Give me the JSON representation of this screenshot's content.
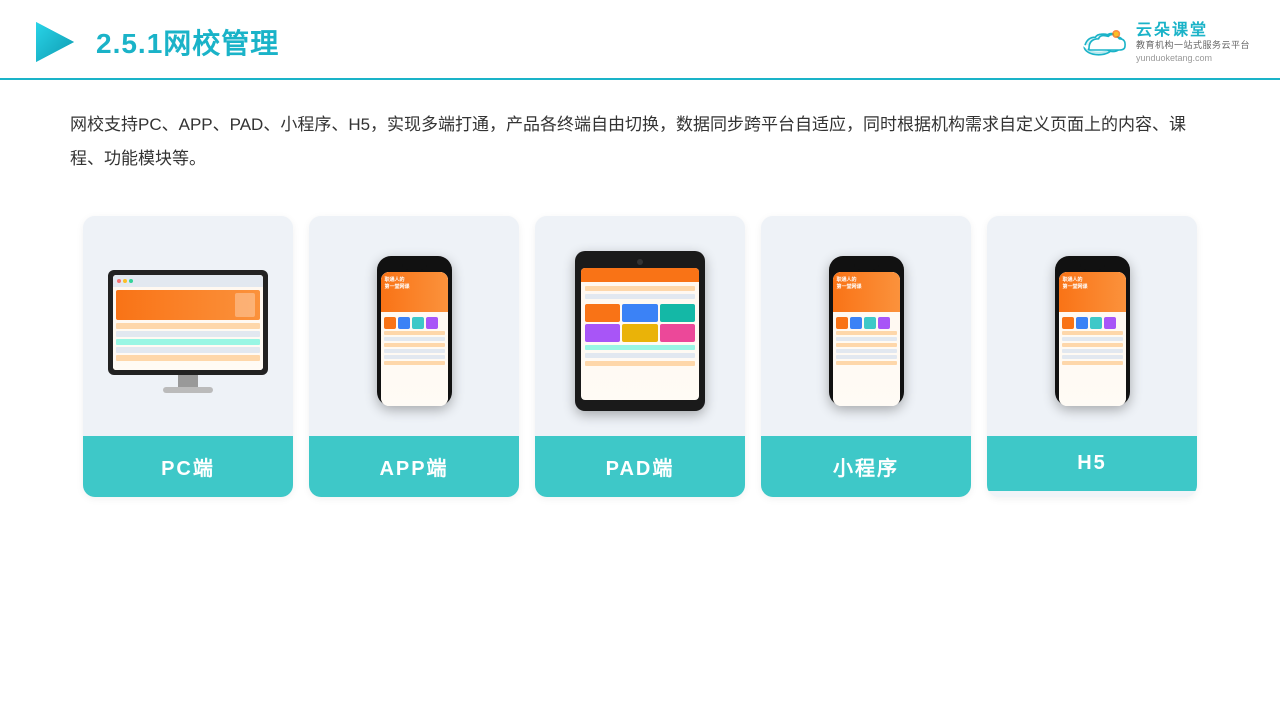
{
  "header": {
    "title_prefix": "2.5.1",
    "title_main": "网校管理",
    "brand_name": "云朵课堂",
    "brand_tagline": "教育机构一站\n式服务云平台",
    "brand_url": "yunduoketang.com"
  },
  "description": {
    "text": "网校支持PC、APP、PAD、小程序、H5，实现多端打通，产品各终端自由切换，数据同步跨平台自适应，同时根据机构需求自定义页面上的内容、课程、功能模块等。"
  },
  "cards": [
    {
      "id": "pc",
      "label": "PC端",
      "device_type": "pc"
    },
    {
      "id": "app",
      "label": "APP端",
      "device_type": "phone"
    },
    {
      "id": "pad",
      "label": "PAD端",
      "device_type": "tablet"
    },
    {
      "id": "miniapp",
      "label": "小程序",
      "device_type": "phone"
    },
    {
      "id": "h5",
      "label": "H5",
      "device_type": "phone"
    }
  ],
  "colors": {
    "accent": "#1ab3c8",
    "card_label_bg": "#3ec8c8",
    "header_line": "#1ab3c8"
  }
}
